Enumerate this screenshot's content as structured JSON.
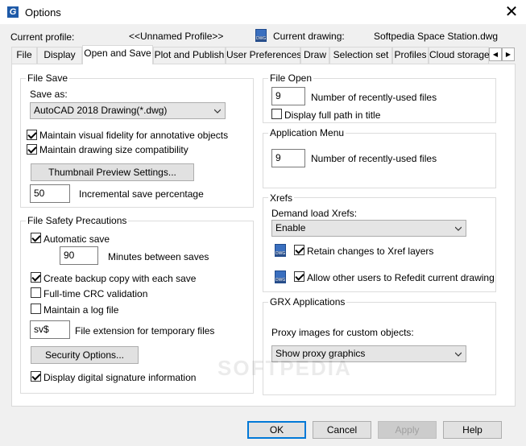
{
  "window": {
    "title": "Options",
    "close_glyph": "✕"
  },
  "profile": {
    "current_profile_label": "Current profile:",
    "current_profile_value": "<<Unnamed Profile>>",
    "current_drawing_label": "Current drawing:",
    "current_drawing_value": "Softpedia Space Station.dwg"
  },
  "tabs": [
    {
      "label": "File"
    },
    {
      "label": "Display"
    },
    {
      "label": "Open and Save",
      "active": true
    },
    {
      "label": "Plot and Publish"
    },
    {
      "label": "User Preferences"
    },
    {
      "label": "Draw"
    },
    {
      "label": "Selection set"
    },
    {
      "label": "Profiles"
    },
    {
      "label": "Cloud storage"
    }
  ],
  "tab_scroll": {
    "left": "◀",
    "right": "▶"
  },
  "file_save": {
    "title": "File Save",
    "save_as_label": "Save as:",
    "save_as_value": "AutoCAD 2018 Drawing(*.dwg)",
    "visual_fidelity_label": "Maintain visual fidelity for annotative objects",
    "visual_fidelity_checked": true,
    "drawing_size_label": "Maintain drawing size compatibility",
    "drawing_size_checked": true,
    "thumbnail_button": "Thumbnail Preview Settings...",
    "incremental_value": "50",
    "incremental_label": "Incremental save percentage"
  },
  "file_safety": {
    "title": "File Safety Precautions",
    "autosave_label": "Automatic save",
    "autosave_checked": true,
    "minutes_value": "90",
    "minutes_label": "Minutes between saves",
    "backup_label": "Create backup copy with each save",
    "backup_checked": true,
    "crc_label": "Full-time CRC validation",
    "crc_checked": false,
    "log_label": "Maintain a log file",
    "log_checked": false,
    "ext_value": "sv$",
    "ext_label": "File extension for temporary files",
    "security_button": "Security Options...",
    "signature_label": "Display digital signature information",
    "signature_checked": true
  },
  "file_open": {
    "title": "File Open",
    "recent_value": "9",
    "recent_label": "Number of recently-used files",
    "full_path_label": "Display full path in title",
    "full_path_checked": false
  },
  "app_menu": {
    "title": "Application Menu",
    "recent_value": "9",
    "recent_label": "Number of recently-used files"
  },
  "xrefs": {
    "title": "Xrefs",
    "demand_label": "Demand load Xrefs:",
    "demand_value": "Enable",
    "retain_label": "Retain changes to Xref layers",
    "retain_checked": true,
    "refedit_label": "Allow other users to Refedit current drawing",
    "refedit_checked": true
  },
  "grx": {
    "title": "GRX Applications",
    "proxy_label": "Proxy images for custom objects:",
    "proxy_value": "Show proxy graphics"
  },
  "buttons": {
    "ok": "OK",
    "cancel": "Cancel",
    "apply": "Apply",
    "help": "Help"
  },
  "watermark": "SOFTPEDIA",
  "colors": {
    "accent": "#0078d7",
    "icon_blue": "#1e5aa8"
  }
}
